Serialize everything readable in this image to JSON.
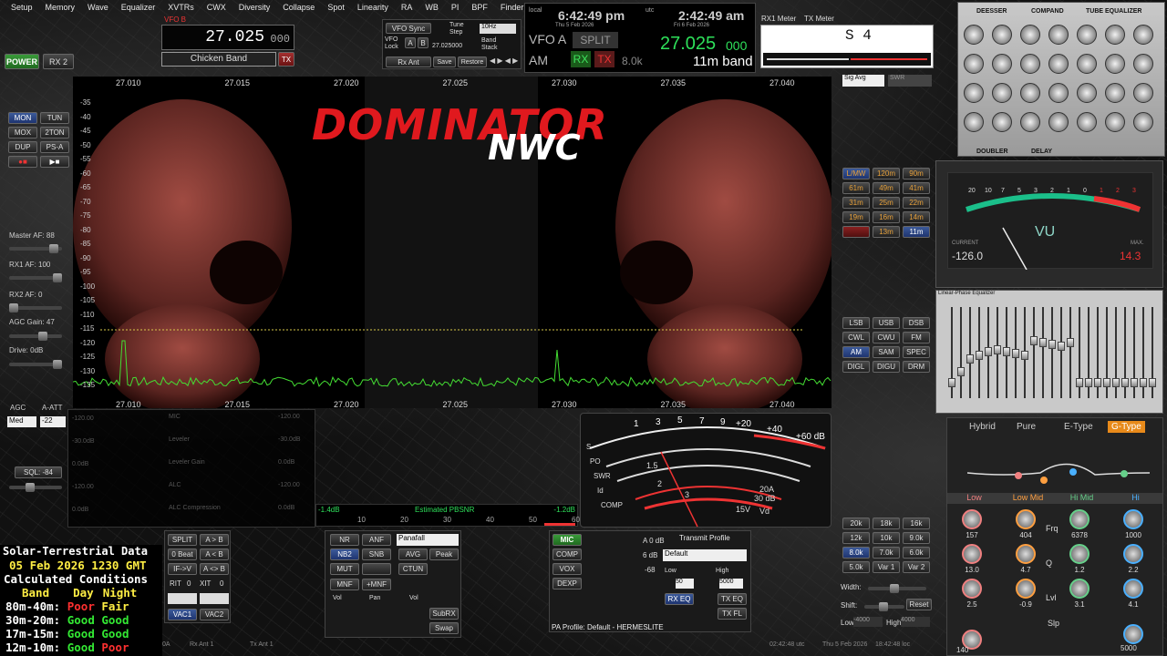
{
  "menu": [
    "Setup",
    "Memory",
    "Wave",
    "Equalizer",
    "XVTRs",
    "CWX",
    "Diversity",
    "Collapse",
    "Spot",
    "Linearity",
    "RA",
    "WB",
    "PI",
    "BPF",
    "Finder",
    "About"
  ],
  "vfo_b": {
    "label": "VFO B",
    "freq": "27.025",
    "freq_small": "000",
    "band": "Chicken Band",
    "tx": "TX"
  },
  "left_buttons": {
    "power": "POWER",
    "rx2": "RX 2",
    "mon": "MON",
    "tun": "TUN",
    "mox": "MOX",
    "twoton": "2TON",
    "dup": "DUP",
    "psa": "PS-A"
  },
  "left_controls": {
    "master_af": "Master AF:  88",
    "rx1_af": "RX1 AF:  100",
    "rx2_af": "RX2 AF:  0",
    "agc_gain": "AGC Gain:  47",
    "drive": "Drive:  0dB",
    "agc": "AGC",
    "a_att": "A-ATT",
    "agc_mode": "Med",
    "att_val": "-22",
    "sql": "SQL: -84"
  },
  "vfo_sync": {
    "label": "VFO Sync",
    "tune_step_label": "Tune Step",
    "tune_step": "10Hz",
    "vfo_lock": "VFO Lock",
    "a": "A",
    "b": "B",
    "lock_freq": "27.025000",
    "band_stack": "Band Stack",
    "rx_ant": "Rx Ant",
    "save": "Save",
    "restore": "Restore"
  },
  "clock": {
    "local_label": "local",
    "local_time": "6:42:49 pm",
    "local_date": "Thu 5 Feb 2026",
    "utc_label": "utc",
    "utc_time": "2:42:49 am",
    "utc_date": "Fri 6 Feb 2026"
  },
  "vfo_a": {
    "label": "VFO A",
    "split": "SPLIT",
    "mode": "AM",
    "rx": "RX",
    "tx": "TX",
    "filter": "8.0k",
    "freq": "27.025",
    "freq_small": "000",
    "band": "11m band"
  },
  "meters": {
    "rx1": "RX1 Meter",
    "tx": "TX Meter",
    "reading": "S 4",
    "sig_avg": "Sig Avg",
    "swr": "SWR"
  },
  "spectrum": {
    "freqs": [
      "27.010",
      "27.015",
      "27.020",
      "27.025",
      "27.030",
      "27.035",
      "27.040"
    ],
    "dbs": [
      "-35",
      "-40",
      "-45",
      "-50",
      "-55",
      "-60",
      "-65",
      "-70",
      "-75",
      "-80",
      "-85",
      "-90",
      "-95",
      "-100",
      "-105",
      "-110",
      "-115",
      "-120",
      "-125",
      "-130",
      "-135"
    ],
    "logo_main": "DOMINATOR",
    "logo_sub": "NWC"
  },
  "band_buttons": [
    [
      "L/MW",
      "120m",
      "90m"
    ],
    [
      "61m",
      "49m",
      "41m"
    ],
    [
      "31m",
      "25m",
      "22m"
    ],
    [
      "19m",
      "16m",
      "14m"
    ],
    [
      "",
      "13m",
      "11m"
    ]
  ],
  "mode_buttons": [
    [
      "LSB",
      "USB",
      "DSB"
    ],
    [
      "CWL",
      "CWU",
      "FM"
    ],
    [
      "AM",
      "SAM",
      "SPEC"
    ],
    [
      "DIGL",
      "DIGU",
      "DRM"
    ]
  ],
  "filter_buttons": [
    [
      "20k",
      "18k",
      "16k"
    ],
    [
      "12k",
      "10k",
      "9.0k"
    ],
    [
      "8.0k",
      "7.0k",
      "6.0k"
    ],
    [
      "5.0k",
      "Var 1",
      "Var 2"
    ]
  ],
  "filter_controls": {
    "width": "Width:",
    "shift": "Shift:",
    "reset": "Reset",
    "low": "Low",
    "low_val": "-4000",
    "high": "High",
    "high_val": "4000"
  },
  "levels": {
    "rows": [
      "-120.00",
      "-30.0dB",
      "0.0dB",
      "-120.00",
      "0.0dB"
    ],
    "labels": [
      "MIC",
      "Leveler",
      "Leveler Gain",
      "ALC",
      "ALC Compression"
    ],
    "pbsnr": "Estimated PBSNR",
    "left_val": "-1.4dB",
    "right_val": "-1.2dB",
    "scale": [
      "10",
      "20",
      "30",
      "40",
      "50",
      "60"
    ]
  },
  "analog_meter": {
    "scale_top": [
      "1",
      "3",
      "5",
      "7",
      "9",
      "+20",
      "+40",
      "+60 dB"
    ],
    "rows": [
      "S",
      "PO",
      "SWR",
      "Id",
      "COMP"
    ],
    "vals": [
      "1.5",
      "2",
      "3",
      "20A",
      "30 dB",
      "15V",
      "Vd"
    ]
  },
  "bottom_left": {
    "split": "SPLIT",
    "ab": "A > B",
    "zero_beat": "0 Beat",
    "ba": "A < B",
    "if_v": "IF->V",
    "swap": "A <> B",
    "rit": "RIT",
    "rit_val": "0",
    "xit": "XIT",
    "xit_val": "0",
    "vac1": "VAC1",
    "vac2": "VAC2"
  },
  "dsp": {
    "nr": "NR",
    "anf": "ANF",
    "nb2": "NB2",
    "snb": "SNB",
    "mut": "MUT",
    "mnf": "MNF",
    "plus_mnf": "+MNF",
    "display": "Panafall",
    "avg": "AVG",
    "peak": "Peak",
    "ctun": "CTUN",
    "vol": "Vol",
    "pan": "Pan",
    "vol2": "Vol",
    "subrx": "SubRX",
    "swap": "Swap"
  },
  "tx": {
    "mic": "MIC",
    "comp": "COMP",
    "vox": "VOX",
    "dexp": "DEXP",
    "mic_db": "A 0 dB",
    "comp_db": "6 dB",
    "vox_val": "-68",
    "profile_label": "Transmit Profile",
    "profile": "Default",
    "low": "Low",
    "high": "High",
    "low_val": "50",
    "high_val": "5000",
    "rx_eq": "RX EQ",
    "tx_eq": "TX EQ",
    "tx_fl": "TX FL",
    "pa_profile": "PA Profile: Default - HERMESLITE"
  },
  "solar": {
    "title": "Solar-Terrestrial Data",
    "date": "05 Feb 2026 1230 GMT",
    "sub": "Calculated Conditions",
    "header": [
      "Band",
      "Day",
      "Night"
    ],
    "rows": [
      [
        "80m-40m:",
        "Poor",
        "Fair"
      ],
      [
        "30m-20m:",
        "Good",
        "Good"
      ],
      [
        "17m-15m:",
        "Good",
        "Good"
      ],
      [
        "12m-10m:",
        "Good",
        "Poor"
      ]
    ]
  },
  "status_bar": {
    "left": "0A",
    "rx_ant": "Rx Ant 1",
    "tx_ant": "Tx Ant 1",
    "utc": "02:42:48 utc",
    "date": "Thu 5 Feb 2026",
    "local": "18:42:48 loc"
  },
  "plugins": {
    "deesser": "DEESSER",
    "compand": "COMPAND",
    "tube_eq": "TUBE EQUALIZER",
    "doubler": "DOUBLER",
    "delay": "DELAY",
    "vu": "VU",
    "vu_current_label": "CURRENT",
    "vu_current": "-126.0",
    "vu_max_label": "MAX.",
    "vu_max": "14.3",
    "vu_scale": [
      "20",
      "10",
      "7",
      "5",
      "3",
      "2",
      "1",
      "0",
      "1",
      "2",
      "3"
    ],
    "linear_eq": "Linear-Phase Equalizer",
    "eq_type": [
      "Hybrid",
      "Pure",
      "E-Type",
      "G-Type"
    ],
    "bands": [
      "Low",
      "Low Mid",
      "Hi Mid",
      "Hi"
    ],
    "freq_vals": [
      "157",
      "404",
      "6378",
      "1000"
    ],
    "q_vals": [
      "13.0",
      "4.7",
      "1.2",
      "2.2"
    ],
    "lvl_vals": [
      "2.5",
      "-0.9",
      "3.1",
      "4.1"
    ],
    "frq": "Frq",
    "q": "Q",
    "lvl": "Lvl",
    "slp": "Slp",
    "last_vals": [
      "140",
      "5000"
    ]
  },
  "colors": {
    "accent_green": "#2ee05a",
    "vfo_red": "#e33333",
    "band_orange": "#e88a1a",
    "poor": "#ff3030",
    "fair": "#ffee44",
    "good": "#33e833"
  }
}
